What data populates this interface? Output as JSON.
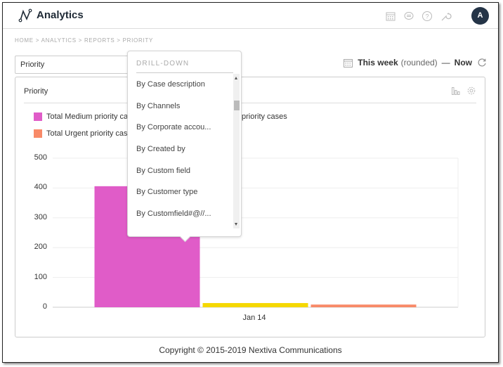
{
  "app": {
    "title": "Analytics",
    "avatar_initial": "A"
  },
  "topbar_icons": [
    "calendar-icon",
    "chat-icon",
    "help-icon",
    "wrench-icon"
  ],
  "breadcrumb": "HOME > ANALYTICS > REPORTS > PRIORITY",
  "report_select": {
    "value": "Priority"
  },
  "date_range": {
    "start": "This week",
    "qualifier": "(rounded)",
    "separator": "—",
    "end": "Now"
  },
  "panel": {
    "title": "Priority"
  },
  "drilldown": {
    "heading": "DRILL-DOWN",
    "items": [
      "By Case description",
      "By Channels",
      "By Corporate accou...",
      "By Created by",
      "By Custom field",
      "By Customer type",
      "By Customfield#@//..."
    ]
  },
  "legend": [
    {
      "label": "Total Medium priority cases",
      "color": "#e05cc8"
    },
    {
      "label": "Total Urgent priority cases",
      "color": "#f88a68"
    },
    {
      "label": "priority cases",
      "color": "#f5d800"
    }
  ],
  "chart_data": {
    "type": "bar",
    "categories": [
      "Jan 14"
    ],
    "series": [
      {
        "name": "Total Medium priority cases",
        "color": "#e05cc8",
        "values": [
          406
        ]
      },
      {
        "name": "Total ... priority cases",
        "color": "#f5d800",
        "values": [
          14
        ]
      },
      {
        "name": "Total Urgent priority cases",
        "color": "#f88a68",
        "values": [
          9
        ]
      }
    ],
    "ylim": [
      0,
      500
    ],
    "yticks": [
      0,
      100,
      200,
      300,
      400,
      500
    ],
    "xlabel": "",
    "ylabel": "",
    "grid": true,
    "legend_position": "top-left"
  },
  "footer": "Copyright © 2015-2019 Nextiva Communications"
}
